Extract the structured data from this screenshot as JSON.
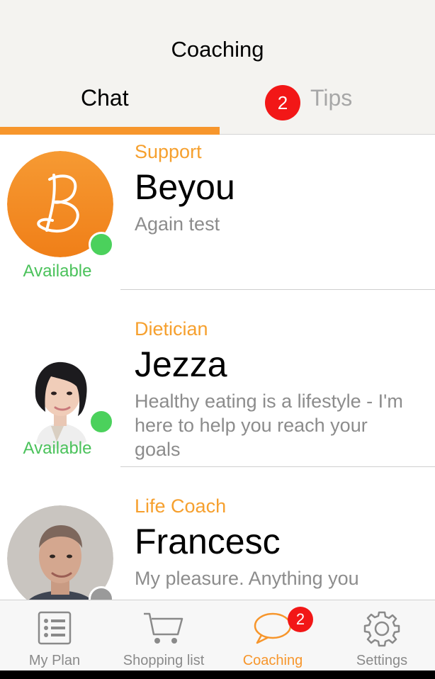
{
  "header": {
    "title": "Coaching",
    "tabs": [
      {
        "label": "Chat",
        "active": true
      },
      {
        "label": "Tips",
        "active": false,
        "badge": "2"
      }
    ]
  },
  "coaches": [
    {
      "role": "Support",
      "name": "Beyou",
      "message": "Again test",
      "status": "Available"
    },
    {
      "role": "Dietician",
      "name": "Jezza",
      "message": "Healthy eating is a lifestyle - I'm here to help you reach your goals",
      "status": "Available"
    },
    {
      "role": "Life Coach",
      "name": "Francesc",
      "message": "My pleasure. Anything you",
      "status": ""
    }
  ],
  "tabbar": {
    "items": [
      {
        "label": "My Plan",
        "icon": "list-icon",
        "active": false
      },
      {
        "label": "Shopping list",
        "icon": "cart-icon",
        "active": false
      },
      {
        "label": "Coaching",
        "icon": "chat-bubble-icon",
        "active": true,
        "badge": "2"
      },
      {
        "label": "Settings",
        "icon": "gear-icon",
        "active": false
      }
    ]
  },
  "colors": {
    "accent": "#f7962c",
    "available": "#4bc25b",
    "badge": "#f21717",
    "muted": "#8c8c8c"
  }
}
